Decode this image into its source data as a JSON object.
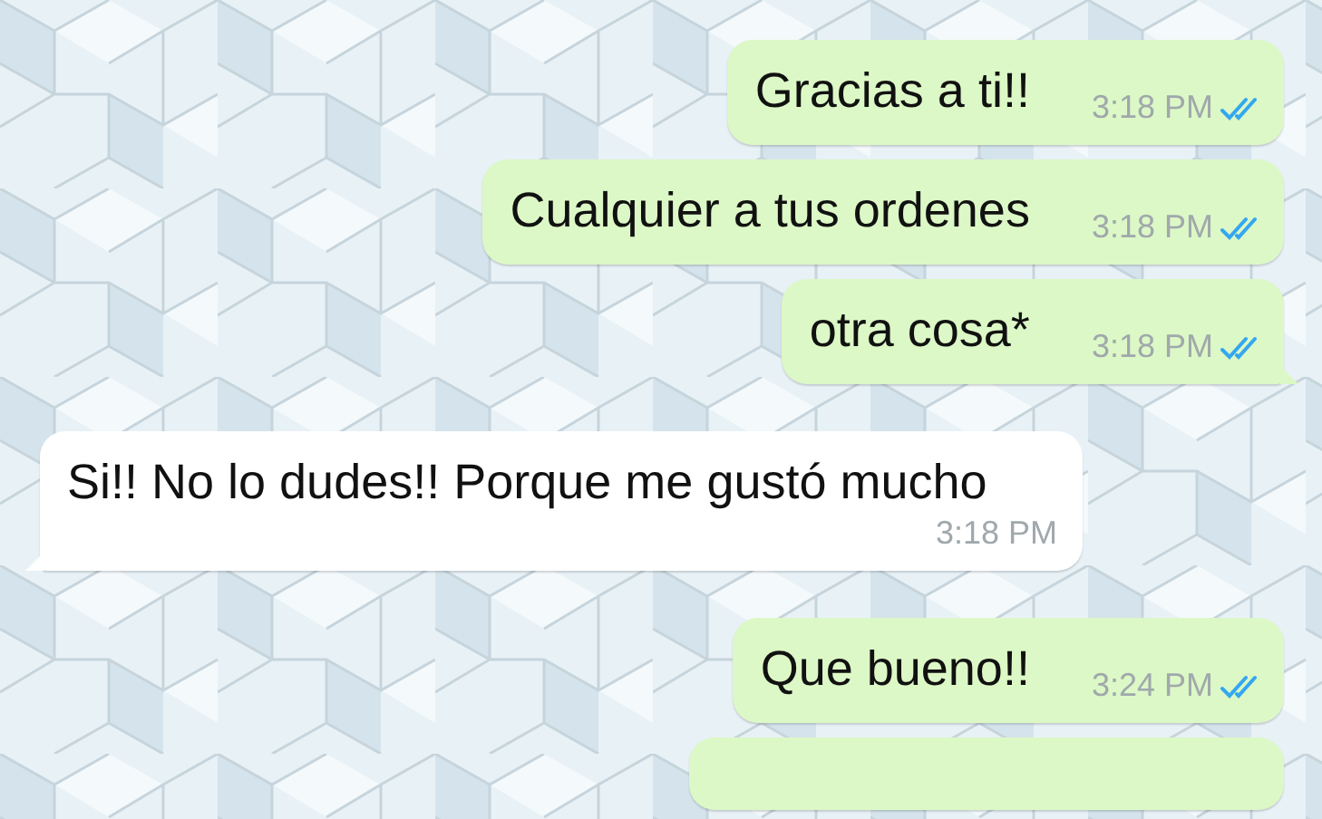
{
  "messages": [
    {
      "kind": "outgoing",
      "text": "Gracias a ti!!",
      "time": "3:18 PM",
      "read": true,
      "tail": false
    },
    {
      "kind": "outgoing",
      "text": "Cualquier a tus ordenes",
      "time": "3:18 PM",
      "read": true,
      "tail": false
    },
    {
      "kind": "outgoing",
      "text": "otra cosa*",
      "time": "3:18 PM",
      "read": true,
      "tail": true
    },
    {
      "kind": "incoming",
      "text": "Si!! No lo dudes!! Porque me gustó mucho",
      "time": "3:18 PM",
      "tail": true
    },
    {
      "kind": "outgoing",
      "text": "Que bueno!!",
      "time": "3:24 PM",
      "read": true,
      "tail": false
    },
    {
      "kind": "partial"
    }
  ]
}
